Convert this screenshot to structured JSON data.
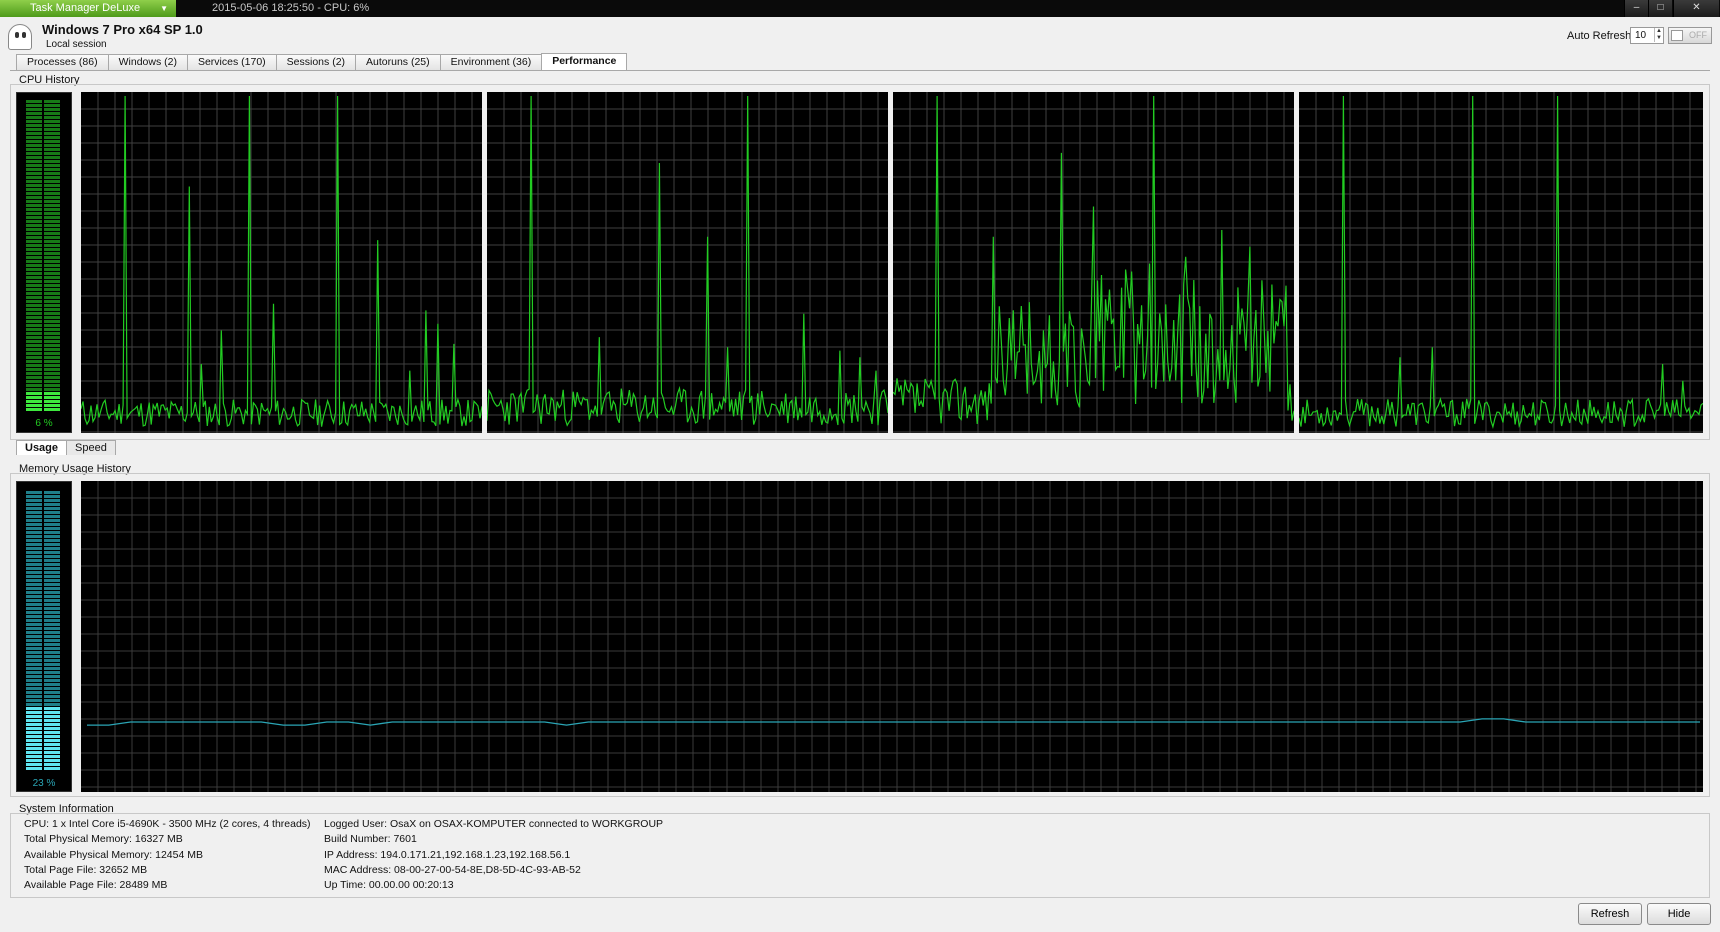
{
  "titlebar": {
    "app_menu": "Task Manager DeLuxe",
    "title": "2015-05-06 18:25:50 - CPU: 6%",
    "minimize": "–",
    "maximize": "□",
    "close": "✕"
  },
  "header": {
    "os_title": "Windows 7 Pro x64 SP 1.0",
    "session": "Local session",
    "auto_refresh_label": "Auto Refresh",
    "auto_refresh_value": "10",
    "toggle_label": "OFF"
  },
  "tabs": [
    {
      "label": "Processes (86)"
    },
    {
      "label": "Windows (2)"
    },
    {
      "label": "Services (170)"
    },
    {
      "label": "Sessions (2)"
    },
    {
      "label": "Autoruns (25)"
    },
    {
      "label": "Environment (36)"
    },
    {
      "label": "Performance",
      "active": true
    }
  ],
  "cpu": {
    "label": "CPU History",
    "usage_text": "6 %",
    "usage_value": 6,
    "color": "#22cc22",
    "graphs": [
      {
        "seed": 11,
        "baseline": 0.06,
        "spikes": [
          [
            0.11,
            1.0
          ],
          [
            0.27,
            0.73
          ],
          [
            0.42,
            1.0
          ],
          [
            0.48,
            0.38
          ],
          [
            0.64,
            1.0
          ],
          [
            0.74,
            0.57
          ],
          [
            0.86,
            0.36
          ],
          [
            0.89,
            0.32
          ],
          [
            0.93,
            0.26
          ],
          [
            0.3,
            0.2
          ],
          [
            0.35,
            0.3
          ],
          [
            0.82,
            0.18
          ]
        ],
        "busy": []
      },
      {
        "seed": 23,
        "baseline": 0.08,
        "spikes": [
          [
            0.11,
            1.0
          ],
          [
            0.43,
            0.8
          ],
          [
            0.55,
            0.58
          ],
          [
            0.65,
            1.0
          ],
          [
            0.79,
            0.35
          ],
          [
            0.28,
            0.28
          ],
          [
            0.6,
            0.25
          ],
          [
            0.88,
            0.24
          ],
          [
            0.93,
            0.22
          ],
          [
            0.97,
            0.18
          ]
        ],
        "busy": []
      },
      {
        "seed": 37,
        "baseline": 0.1,
        "spikes": [
          [
            0.11,
            1.0
          ],
          [
            0.25,
            0.58
          ],
          [
            0.42,
            0.83
          ],
          [
            0.5,
            0.67
          ],
          [
            0.64,
            0.5
          ],
          [
            0.65,
            1.0
          ],
          [
            0.73,
            0.52
          ],
          [
            0.82,
            0.6
          ],
          [
            0.89,
            0.55
          ],
          [
            0.92,
            0.45
          ]
        ],
        "busy": [
          [
            0.25,
            0.45,
            0.3
          ],
          [
            0.47,
            0.62,
            0.4
          ],
          [
            0.62,
            0.98,
            0.35
          ]
        ]
      },
      {
        "seed": 53,
        "baseline": 0.06,
        "spikes": [
          [
            0.11,
            1.0
          ],
          [
            0.43,
            1.0
          ],
          [
            0.64,
            1.0
          ],
          [
            0.25,
            0.22
          ],
          [
            0.33,
            0.25
          ],
          [
            0.9,
            0.2
          ],
          [
            0.95,
            0.15
          ]
        ],
        "busy": []
      }
    ]
  },
  "subtabs": [
    {
      "label": "Usage",
      "active": true
    },
    {
      "label": "Speed"
    }
  ],
  "memory": {
    "label": "Memory Usage History",
    "usage_text": "23 %",
    "usage_value": 23,
    "color": "#2aa5b5",
    "series": [
      0.215,
      0.215,
      0.225,
      0.225,
      0.225,
      0.225,
      0.225,
      0.225,
      0.225,
      0.215,
      0.215,
      0.225,
      0.225,
      0.215,
      0.225,
      0.225,
      0.225,
      0.225,
      0.225,
      0.225,
      0.225,
      0.225,
      0.215,
      0.225,
      0.225,
      0.225,
      0.225,
      0.225,
      0.225,
      0.225,
      0.225,
      0.225,
      0.225,
      0.225,
      0.225,
      0.225,
      0.225,
      0.225,
      0.225,
      0.225,
      0.225,
      0.225,
      0.225,
      0.225,
      0.225,
      0.225,
      0.225,
      0.225,
      0.225,
      0.225,
      0.225,
      0.225,
      0.225,
      0.225,
      0.225,
      0.225,
      0.225,
      0.225,
      0.225,
      0.225,
      0.225,
      0.225,
      0.225,
      0.225,
      0.235,
      0.235,
      0.225,
      0.225,
      0.225,
      0.225,
      0.225,
      0.225,
      0.225,
      0.225,
      0.225
    ]
  },
  "system_info": {
    "label": "System Information",
    "left": [
      "CPU: 1 x Intel Core i5-4690K - 3500 MHz (2 cores, 4 threads)",
      "Total Physical Memory: 16327 MB",
      "Available Physical Memory: 12454 MB",
      "Total Page File: 32652 MB",
      "Available Page File: 28489 MB"
    ],
    "right": [
      "Logged User: OsaX on OSAX-KOMPUTER connected to WORKGROUP",
      "Build Number: 7601",
      "IP Address: 194.0.171.21,192.168.1.23,192.168.56.1",
      "MAC Address: 08-00-27-00-54-8E,D8-5D-4C-93-AB-52",
      "Up Time: 00.00.00 00:20:13"
    ]
  },
  "buttons": {
    "refresh": "Refresh",
    "hide": "Hide"
  }
}
